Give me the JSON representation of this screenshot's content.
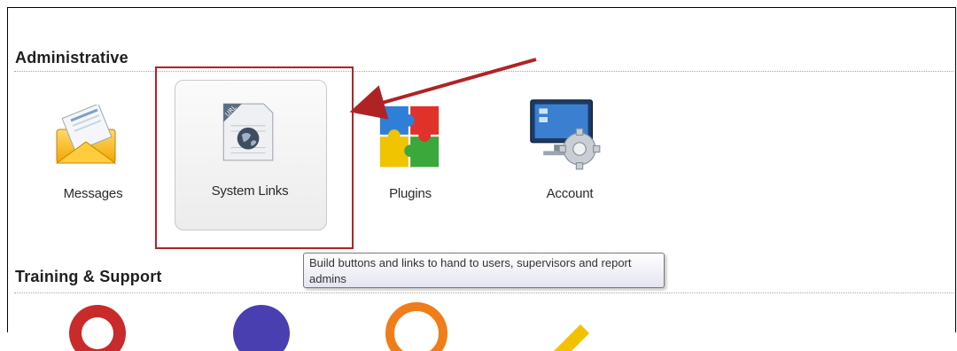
{
  "sections": {
    "administrative": "Administrative",
    "training": "Training & Support"
  },
  "tiles": [
    {
      "label": "Messages",
      "icon": "envelope-icon"
    },
    {
      "label": "System Links",
      "icon": "url-document-globe-icon"
    },
    {
      "label": "Plugins",
      "icon": "puzzle-icon"
    },
    {
      "label": "Account",
      "icon": "monitor-gear-icon"
    }
  ],
  "tooltip": {
    "text": "Build buttons and links to hand to users, supervisors and report admins"
  },
  "colors": {
    "highlight": "#b02325",
    "arrow": "#b02325"
  }
}
